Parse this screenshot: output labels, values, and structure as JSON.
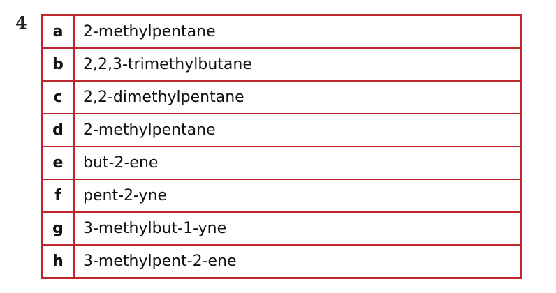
{
  "question_number": "4",
  "rows": [
    {
      "letter": "a",
      "name": "2-methylpentane"
    },
    {
      "letter": "b",
      "name": "2,2,3-trimethylbutane"
    },
    {
      "letter": "c",
      "name": "2,2-dimethylpentane"
    },
    {
      "letter": "d",
      "name": "2-methylpentane"
    },
    {
      "letter": "e",
      "name": "but-2-ene"
    },
    {
      "letter": "f",
      "name": "pent-2-yne"
    },
    {
      "letter": "g",
      "name": "3-methylbut-1-yne"
    },
    {
      "letter": "h",
      "name": "3-methylpent-2-ene"
    }
  ],
  "colors": {
    "border": "#c0272d"
  }
}
